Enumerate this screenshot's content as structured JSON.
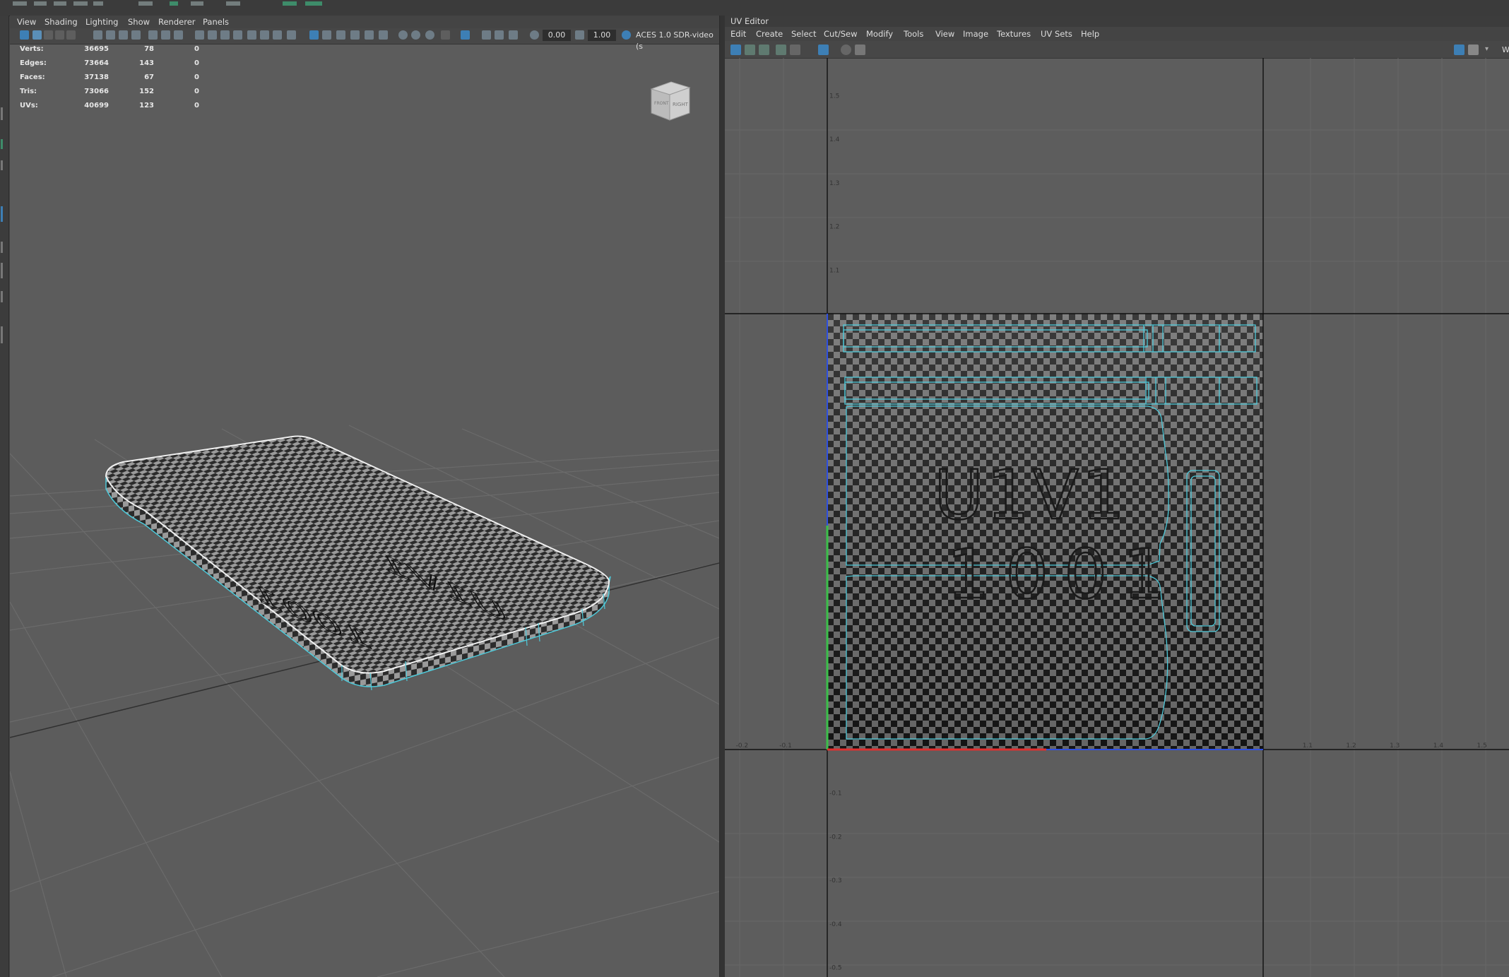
{
  "viewport": {
    "menu": [
      "View",
      "Shading",
      "Lighting",
      "Show",
      "Renderer",
      "Panels"
    ],
    "toolbar": {
      "exposure": "0.00",
      "gamma": "1.00",
      "colorspace": "ACES 1.0 SDR-video (s"
    },
    "hud": [
      {
        "label": "Verts:",
        "total": "36695",
        "selected": "78",
        "extra": "0"
      },
      {
        "label": "Edges:",
        "total": "73664",
        "selected": "143",
        "extra": "0"
      },
      {
        "label": "Faces:",
        "total": "37138",
        "selected": "67",
        "extra": "0"
      },
      {
        "label": "Tris:",
        "total": "73066",
        "selected": "152",
        "extra": "0"
      },
      {
        "label": "UVs:",
        "total": "40699",
        "selected": "123",
        "extra": "0"
      }
    ],
    "viewcube": {
      "right": "RIGHT",
      "front": "FRONT"
    },
    "mesh_text": [
      "U1V1",
      "1001"
    ]
  },
  "uv_editor": {
    "title": "UV Editor",
    "menu": [
      "Edit",
      "Create",
      "Select",
      "Cut/Sew",
      "Modify",
      "Tools",
      "View",
      "Image",
      "Textures",
      "UV Sets",
      "Help"
    ],
    "toolbar_cut_label": "W",
    "tile_text": [
      "U1V1",
      "1001"
    ],
    "u_ticks": [
      {
        "v": -0.2,
        "t": "-0.2"
      },
      {
        "v": -0.1,
        "t": "-0.1"
      },
      {
        "v": 1.1,
        "t": "1.1"
      },
      {
        "v": 1.2,
        "t": "1.2"
      },
      {
        "v": 1.3,
        "t": "1.3"
      },
      {
        "v": 1.4,
        "t": "1.4"
      },
      {
        "v": 1.5,
        "t": "1.5"
      }
    ],
    "v_ticks": [
      {
        "v": 1.5,
        "t": "1.5"
      },
      {
        "v": 1.4,
        "t": "1.4"
      },
      {
        "v": 1.3,
        "t": "1.3"
      },
      {
        "v": 1.2,
        "t": "1.2"
      },
      {
        "v": 1.1,
        "t": "1.1"
      },
      {
        "v": -0.1,
        "t": "-0.1"
      },
      {
        "v": -0.2,
        "t": "-0.2"
      },
      {
        "v": -0.3,
        "t": "-0.3"
      },
      {
        "v": -0.4,
        "t": "-0.4"
      },
      {
        "v": -0.5,
        "t": "-0.5"
      }
    ]
  },
  "colors": {
    "wire": "#4ec9d9",
    "select": "#3d7fb5",
    "vaxis": "#3cbf4a",
    "uaxis": "#e03030",
    "bluaxis": "#3050e0"
  }
}
